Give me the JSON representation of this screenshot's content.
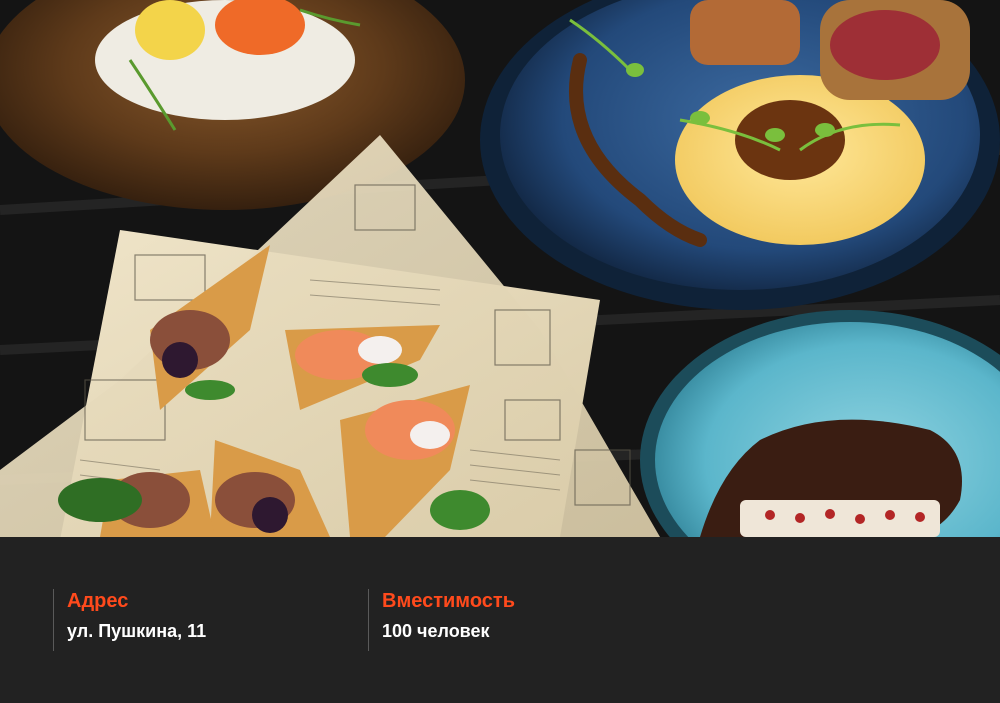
{
  "photo": {
    "subject": "food-platter-photo"
  },
  "info": {
    "address": {
      "label": "Адрес",
      "value": "ул. Пушкина, 11"
    },
    "capacity": {
      "label": "Вместимость",
      "value": "100 человек"
    },
    "colors": {
      "accent": "#ff4a1c",
      "text": "#ffffff",
      "background": "#222222",
      "divider": "#5a5a5a"
    }
  }
}
